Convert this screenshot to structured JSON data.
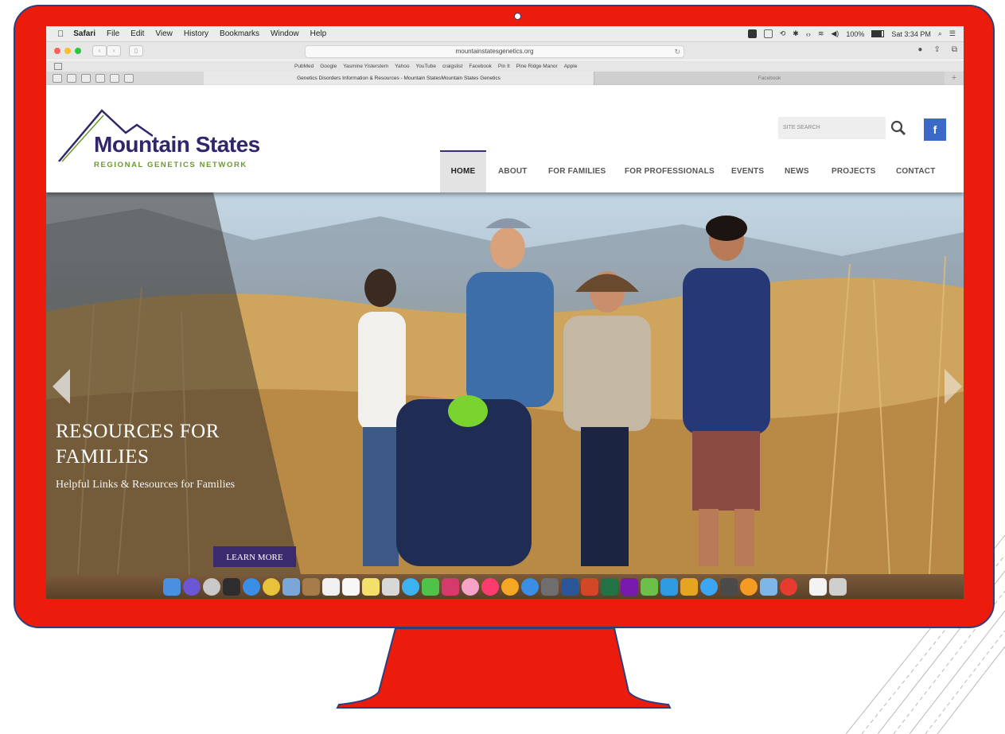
{
  "menubar": {
    "apple": "",
    "app_name": "Safari",
    "items": [
      "File",
      "Edit",
      "View",
      "History",
      "Bookmarks",
      "Window",
      "Help"
    ],
    "battery": "100%",
    "clock": "Sat 3:34 PM"
  },
  "toolbar": {
    "url": "mountainstatesgenetics.org"
  },
  "bookmarks": [
    "PubMed",
    "Google",
    "Yasmine Yisterstem",
    "Yahoo",
    "YouTube",
    "craigslist",
    "Facebook",
    "Pin It",
    "Pine Ridge Manor",
    "Apple"
  ],
  "tabs": [
    {
      "label": "Genetics Disorders Information & Resources - Mountain StatesMountain States Genetics",
      "active": true
    },
    {
      "label": "Facebook",
      "active": false
    }
  ],
  "site": {
    "logo_title": "Mountain States",
    "logo_subtitle": "REGIONAL GENETICS NETWORK",
    "search_placeholder": "SITE SEARCH",
    "facebook": "f",
    "nav": [
      "HOME",
      "ABOUT",
      "FOR FAMILIES",
      "FOR PROFESSIONALS",
      "EVENTS",
      "NEWS",
      "PROJECTS",
      "CONTACT"
    ],
    "active_nav": "HOME"
  },
  "hero": {
    "title": "RESOURCES FOR FAMILIES",
    "subtitle": "Helpful Links & Resources for Families",
    "cta": "LEARN MORE"
  },
  "colors": {
    "bezel": "#ec1c0d",
    "bezel_border": "#2c3f7a",
    "brand_purple": "#2f2769",
    "brand_green": "#6a9a2c",
    "facebook_blue": "#3b69c8"
  }
}
